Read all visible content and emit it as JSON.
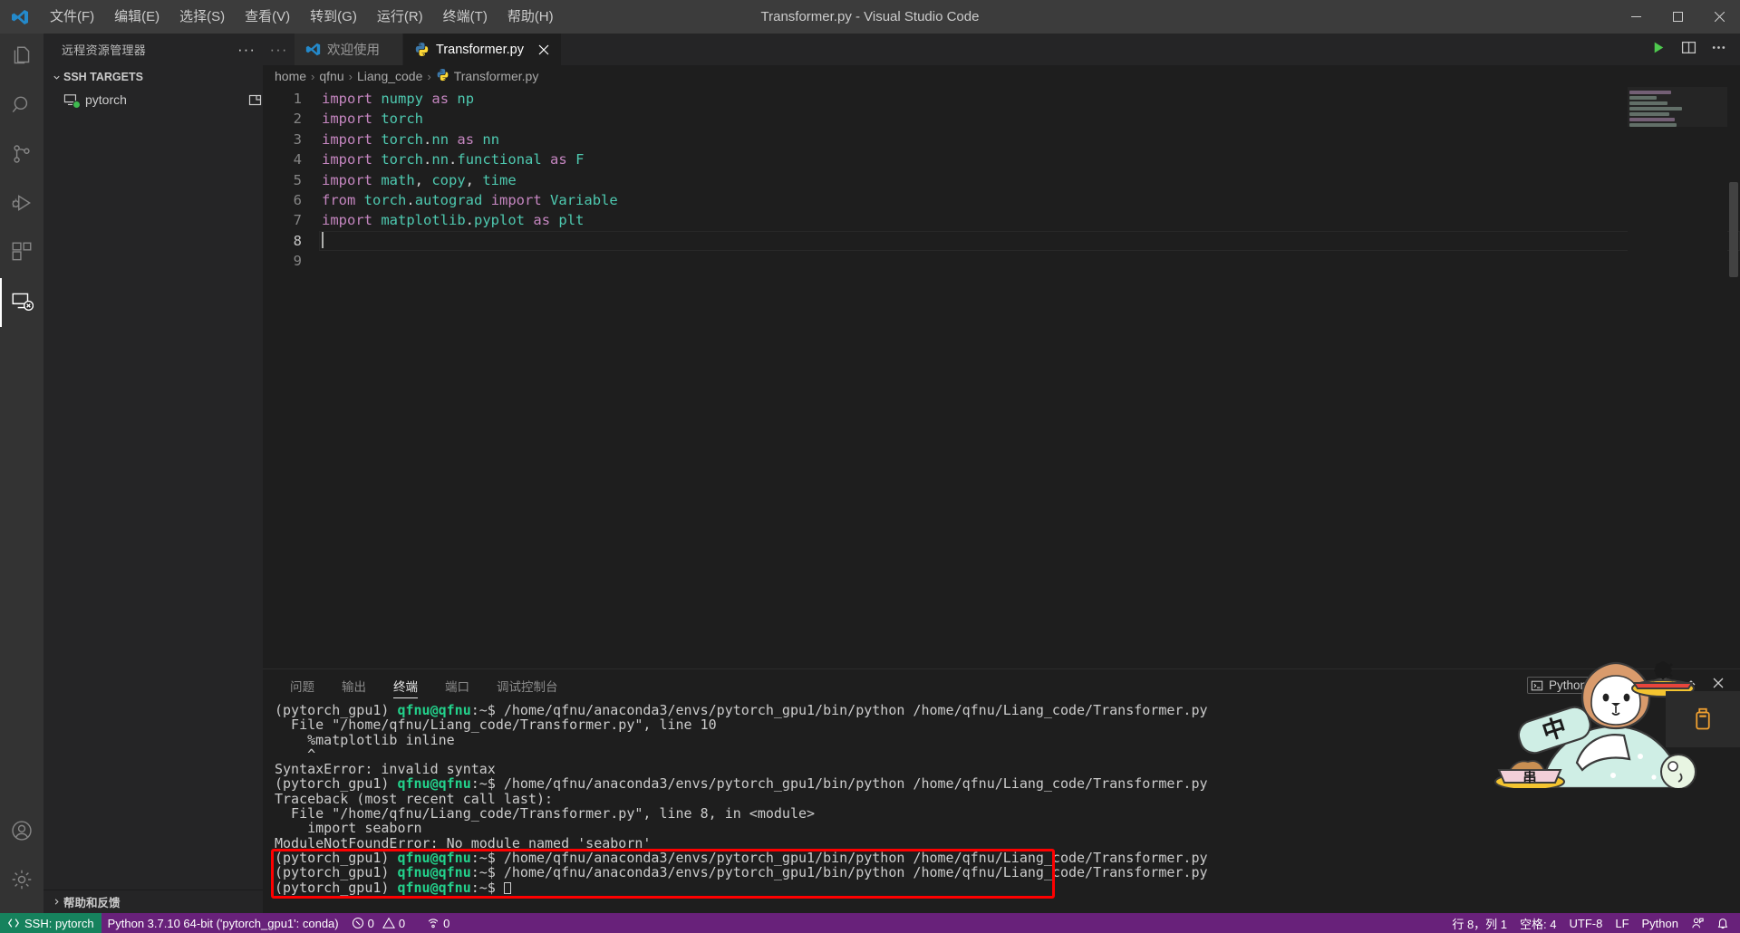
{
  "window": {
    "title": "Transformer.py - Visual Studio Code",
    "logo_icon": "vscode-logo-icon",
    "controls": [
      {
        "name": "minimize-button",
        "icon": "minimize-icon"
      },
      {
        "name": "maximize-button",
        "icon": "maximize-icon"
      },
      {
        "name": "close-button",
        "icon": "close-icon"
      }
    ]
  },
  "menubar": {
    "items": [
      {
        "label": "文件(F)",
        "name": "menu-file"
      },
      {
        "label": "编辑(E)",
        "name": "menu-edit"
      },
      {
        "label": "选择(S)",
        "name": "menu-selection"
      },
      {
        "label": "查看(V)",
        "name": "menu-view"
      },
      {
        "label": "转到(G)",
        "name": "menu-go"
      },
      {
        "label": "运行(R)",
        "name": "menu-run"
      },
      {
        "label": "终端(T)",
        "name": "menu-terminal"
      },
      {
        "label": "帮助(H)",
        "name": "menu-help"
      }
    ]
  },
  "activitybar": {
    "items": [
      {
        "icon": "files-explorer-icon",
        "name": "activity-explorer",
        "active": false
      },
      {
        "icon": "search-icon",
        "name": "activity-search",
        "active": false
      },
      {
        "icon": "source-control-icon",
        "name": "activity-source-control",
        "active": false
      },
      {
        "icon": "run-and-debug-icon",
        "name": "activity-run-debug",
        "active": false
      },
      {
        "icon": "extensions-icon",
        "name": "activity-extensions",
        "active": false
      },
      {
        "icon": "remote-explorer-icon",
        "name": "activity-remote-explorer",
        "active": true
      }
    ],
    "bottom": [
      {
        "icon": "account-icon",
        "name": "activity-account"
      },
      {
        "icon": "gear-icon",
        "name": "activity-settings"
      }
    ]
  },
  "sidebar": {
    "title": "远程资源管理器",
    "more_actions": "···",
    "section_label": "SSH TARGETS",
    "targets": [
      {
        "label": "pytorch",
        "icon": "remote-server-icon",
        "status": "connected",
        "action_icon": "new-window-icon"
      }
    ],
    "footer_label": "帮助和反馈"
  },
  "editor": {
    "tabs": [
      {
        "label": "欢迎使用",
        "icon": "vscode-logo-icon",
        "active": false,
        "closable": false
      },
      {
        "label": "Transformer.py",
        "icon": "python-file-icon",
        "active": true,
        "closable": true
      }
    ],
    "actions": [
      {
        "icon": "run-python-file-icon",
        "name": "run-file-button"
      },
      {
        "icon": "split-editor-icon",
        "name": "split-editor-button"
      },
      {
        "icon": "more-actions-icon",
        "name": "editor-more-actions-button"
      }
    ],
    "breadcrumb": [
      {
        "label": "home",
        "icon": null
      },
      {
        "label": "qfnu",
        "icon": null
      },
      {
        "label": "Liang_code",
        "icon": null
      },
      {
        "label": "Transformer.py",
        "icon": "python-file-icon"
      }
    ],
    "breadcrumb_separator": "›",
    "line_numbers": [
      "1",
      "2",
      "3",
      "4",
      "5",
      "6",
      "7",
      "8",
      "9"
    ],
    "active_line": 8,
    "lines": [
      {
        "n": 1,
        "tokens": [
          {
            "t": "import",
            "c": "kw"
          },
          {
            "t": " ",
            "c": "plain"
          },
          {
            "t": "numpy",
            "c": "mod"
          },
          {
            "t": " ",
            "c": "plain"
          },
          {
            "t": "as",
            "c": "as"
          },
          {
            "t": " ",
            "c": "plain"
          },
          {
            "t": "np",
            "c": "mod"
          }
        ]
      },
      {
        "n": 2,
        "tokens": [
          {
            "t": "import",
            "c": "kw"
          },
          {
            "t": " ",
            "c": "plain"
          },
          {
            "t": "torch",
            "c": "mod"
          }
        ]
      },
      {
        "n": 3,
        "tokens": [
          {
            "t": "import",
            "c": "kw"
          },
          {
            "t": " ",
            "c": "plain"
          },
          {
            "t": "torch",
            "c": "mod"
          },
          {
            "t": ".",
            "c": "punc"
          },
          {
            "t": "nn",
            "c": "mod"
          },
          {
            "t": " ",
            "c": "plain"
          },
          {
            "t": "as",
            "c": "as"
          },
          {
            "t": " ",
            "c": "plain"
          },
          {
            "t": "nn",
            "c": "mod"
          }
        ]
      },
      {
        "n": 4,
        "tokens": [
          {
            "t": "import",
            "c": "kw"
          },
          {
            "t": " ",
            "c": "plain"
          },
          {
            "t": "torch",
            "c": "mod"
          },
          {
            "t": ".",
            "c": "punc"
          },
          {
            "t": "nn",
            "c": "mod"
          },
          {
            "t": ".",
            "c": "punc"
          },
          {
            "t": "functional",
            "c": "mod"
          },
          {
            "t": " ",
            "c": "plain"
          },
          {
            "t": "as",
            "c": "as"
          },
          {
            "t": " ",
            "c": "plain"
          },
          {
            "t": "F",
            "c": "mod"
          }
        ]
      },
      {
        "n": 5,
        "tokens": [
          {
            "t": "import",
            "c": "kw"
          },
          {
            "t": " ",
            "c": "plain"
          },
          {
            "t": "math",
            "c": "mod"
          },
          {
            "t": ", ",
            "c": "punc"
          },
          {
            "t": "copy",
            "c": "mod"
          },
          {
            "t": ", ",
            "c": "punc"
          },
          {
            "t": "time",
            "c": "mod"
          }
        ]
      },
      {
        "n": 6,
        "tokens": [
          {
            "t": "from",
            "c": "kw"
          },
          {
            "t": " ",
            "c": "plain"
          },
          {
            "t": "torch",
            "c": "mod"
          },
          {
            "t": ".",
            "c": "punc"
          },
          {
            "t": "autograd",
            "c": "mod"
          },
          {
            "t": " ",
            "c": "plain"
          },
          {
            "t": "import",
            "c": "kw"
          },
          {
            "t": " ",
            "c": "plain"
          },
          {
            "t": "Variable",
            "c": "mod"
          }
        ]
      },
      {
        "n": 7,
        "tokens": [
          {
            "t": "import",
            "c": "kw"
          },
          {
            "t": " ",
            "c": "plain"
          },
          {
            "t": "matplotlib",
            "c": "mod"
          },
          {
            "t": ".",
            "c": "punc"
          },
          {
            "t": "pyplot",
            "c": "mod"
          },
          {
            "t": " ",
            "c": "plain"
          },
          {
            "t": "as",
            "c": "as"
          },
          {
            "t": " ",
            "c": "plain"
          },
          {
            "t": "plt",
            "c": "mod"
          }
        ]
      },
      {
        "n": 8,
        "tokens": []
      },
      {
        "n": 9,
        "tokens": []
      }
    ]
  },
  "panel": {
    "tabs": [
      {
        "label": "问题",
        "name": "panel-tab-problems",
        "active": false
      },
      {
        "label": "输出",
        "name": "panel-tab-output",
        "active": false
      },
      {
        "label": "终端",
        "name": "panel-tab-terminal",
        "active": true
      },
      {
        "label": "端口",
        "name": "panel-tab-ports",
        "active": false
      },
      {
        "label": "调试控制台",
        "name": "panel-tab-debug-console",
        "active": false
      }
    ],
    "terminal_selector": {
      "label": "Python",
      "icon": "terminal-icon",
      "chevron": "⌄"
    },
    "actions": [
      {
        "icon": "add-terminal-icon",
        "name": "new-terminal-button"
      },
      {
        "icon": "split-terminal-icon",
        "name": "split-terminal-button"
      },
      {
        "icon": "trash-icon",
        "name": "kill-terminal-button"
      },
      {
        "icon": "maximize-panel-icon",
        "name": "maximize-panel-button"
      },
      {
        "icon": "close-icon",
        "name": "close-panel-button"
      }
    ],
    "terminal_lines": [
      {
        "type": "prompt",
        "env": "(pytorch_gpu1) ",
        "user": "qfnu@qfnu",
        "sep": ":~$ ",
        "cmd": "/home/qfnu/anaconda3/envs/pytorch_gpu1/bin/python /home/qfnu/Liang_code/Transformer.py",
        "highlight": false
      },
      {
        "type": "text",
        "text": "  File \"/home/qfnu/Liang_code/Transformer.py\", line 10",
        "highlight": false
      },
      {
        "type": "text",
        "text": "    %matplotlib inline",
        "highlight": false
      },
      {
        "type": "text",
        "text": "    ^",
        "highlight": false
      },
      {
        "type": "text",
        "text": "SyntaxError: invalid syntax",
        "highlight": false
      },
      {
        "type": "prompt",
        "env": "(pytorch_gpu1) ",
        "user": "qfnu@qfnu",
        "sep": ":~$ ",
        "cmd": "/home/qfnu/anaconda3/envs/pytorch_gpu1/bin/python /home/qfnu/Liang_code/Transformer.py",
        "highlight": false
      },
      {
        "type": "text",
        "text": "Traceback (most recent call last):",
        "highlight": false
      },
      {
        "type": "text",
        "text": "  File \"/home/qfnu/Liang_code/Transformer.py\", line 8, in <module>",
        "highlight": false
      },
      {
        "type": "text",
        "text": "    import seaborn",
        "highlight": false
      },
      {
        "type": "text",
        "text": "ModuleNotFoundError: No module named 'seaborn'",
        "highlight": false
      },
      {
        "type": "prompt",
        "env": "(pytorch_gpu1) ",
        "user": "qfnu@qfnu",
        "sep": ":~$ ",
        "cmd": "/home/qfnu/anaconda3/envs/pytorch_gpu1/bin/python /home/qfnu/Liang_code/Transformer.py",
        "highlight": true
      },
      {
        "type": "prompt",
        "env": "(pytorch_gpu1) ",
        "user": "qfnu@qfnu",
        "sep": ":~$ ",
        "cmd": "/home/qfnu/anaconda3/envs/pytorch_gpu1/bin/python /home/qfnu/Liang_code/Transformer.py",
        "highlight": true
      },
      {
        "type": "prompt-cursor",
        "env": "(pytorch_gpu1) ",
        "user": "qfnu@qfnu",
        "sep": ":~$ ",
        "cmd": "",
        "highlight": true
      }
    ],
    "annotation_color": "#ff0000"
  },
  "statusbar": {
    "remote": {
      "label": "SSH: pytorch",
      "icon": "remote-indicator-icon",
      "color": "#16825d"
    },
    "left_items": [
      {
        "label": "Python 3.7.10 64-bit ('pytorch_gpu1': conda)",
        "name": "status-python-interpreter"
      },
      {
        "label": "0",
        "icon": "error-icon",
        "name": "status-errors"
      },
      {
        "label": "0",
        "icon": "warning-icon",
        "name": "status-warnings"
      },
      {
        "label": "0",
        "icon": "ports-icon",
        "name": "status-ports"
      }
    ],
    "right_items": [
      {
        "label": "行 8，列 1",
        "name": "status-cursor-position"
      },
      {
        "label": "空格: 4",
        "name": "status-indentation"
      },
      {
        "label": "UTF-8",
        "name": "status-encoding"
      },
      {
        "label": "LF",
        "name": "status-eol"
      },
      {
        "label": "Python",
        "name": "status-language-mode"
      },
      {
        "label": "",
        "icon": "feedback-icon",
        "name": "status-feedback"
      },
      {
        "label": "",
        "icon": "bell-icon",
        "name": "status-notifications"
      }
    ],
    "background": "#68217a"
  },
  "ime_widget": {
    "mode_label": "中",
    "food_label": "串",
    "name": "chinese-ime-floating-widget"
  }
}
